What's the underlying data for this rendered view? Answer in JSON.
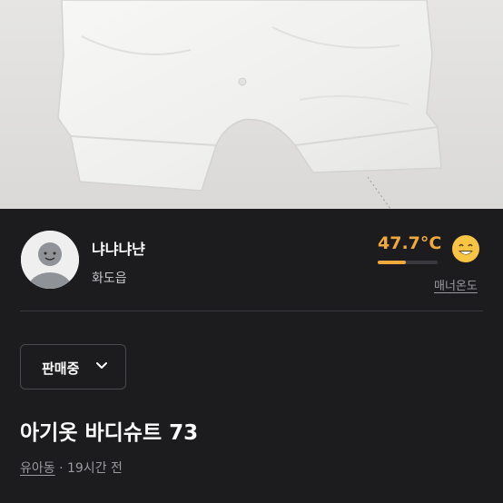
{
  "product": {
    "image_alt": "아기옷 바디슈트 사진",
    "title": "아기옷 바디슈트 73",
    "category": "유아동",
    "time_ago": "· 19시간 전"
  },
  "seller": {
    "nickname": "냐냐냐냔",
    "region": "화도읍",
    "manner_temp": "47.7°C",
    "manner_temp_fraction": 0.477,
    "manner_label": "매너온도",
    "mood_icon": "smile-face-icon"
  },
  "status": {
    "selected": "판매중"
  },
  "colors": {
    "background": "#1c1c1e",
    "temp_accent": "#f0a93a",
    "muted_text": "#9a9aa0"
  }
}
